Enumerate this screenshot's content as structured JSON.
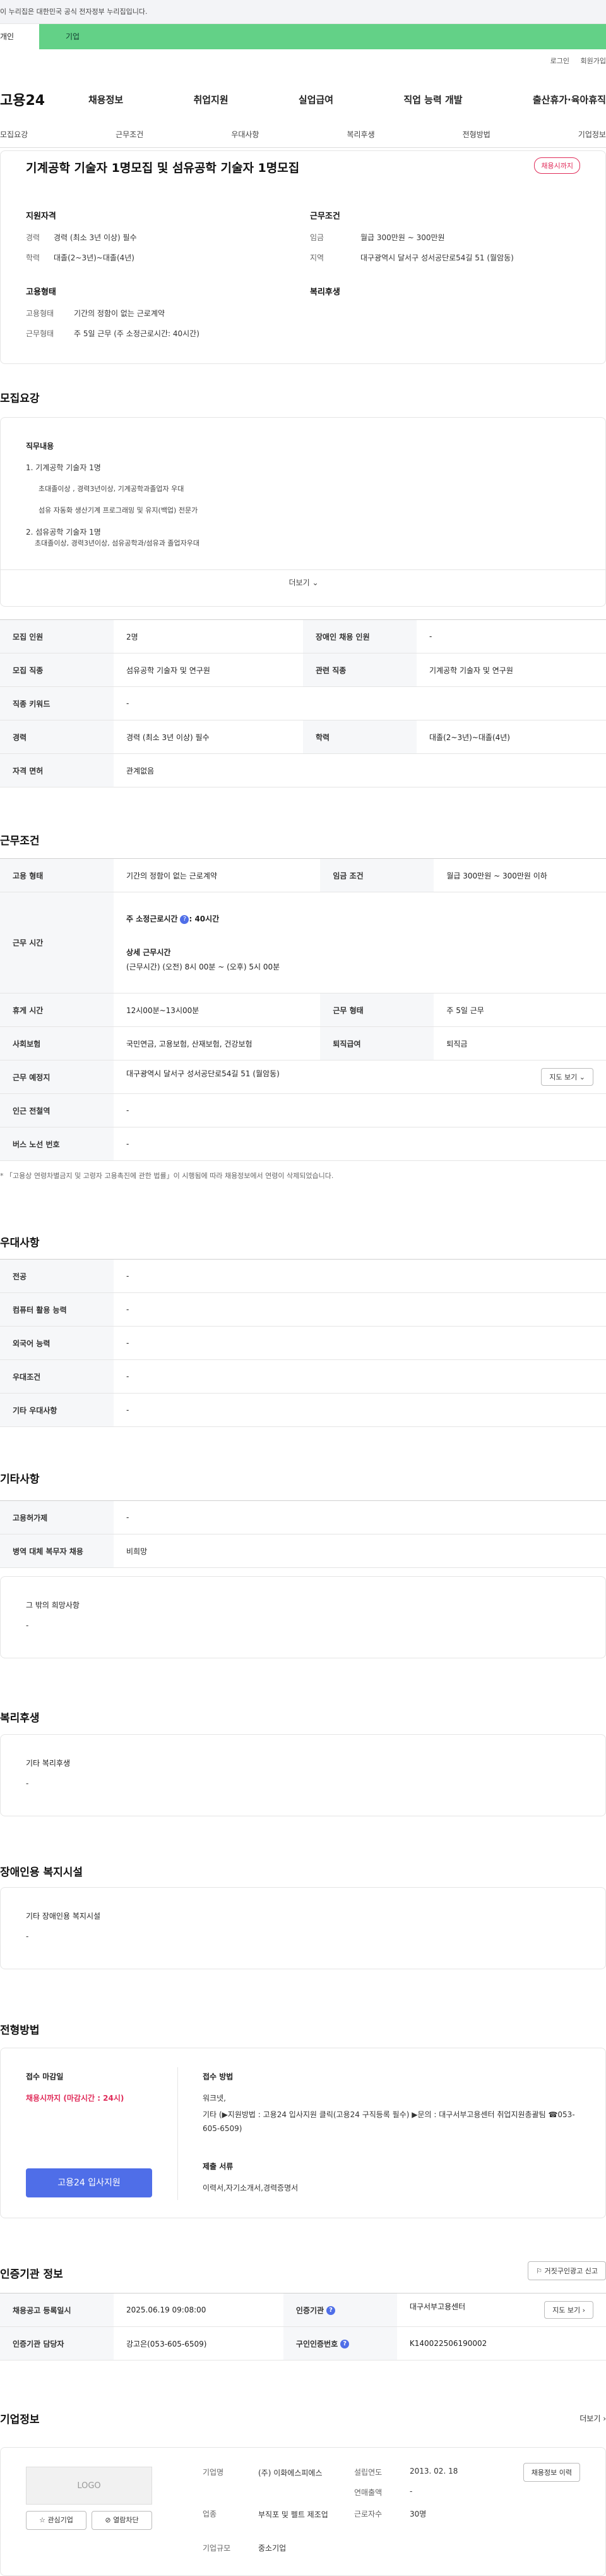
{
  "gov_banner": "이 누리집은 대한민국 공식 전자정부 누리집입니다.",
  "tabs": {
    "t1": "개인",
    "t2": "기업"
  },
  "util": {
    "login": "로그인",
    "join": "회원가입"
  },
  "logo": "고용24",
  "gnb": [
    "채용정보",
    "취업지원",
    "실업급여",
    "직업 능력 개발",
    "출산휴가·육아휴직"
  ],
  "lnb": [
    "모집요강",
    "근무조건",
    "우대사항",
    "복리후생",
    "전형방법",
    "기업정보"
  ],
  "job": {
    "title": "기계공학 기술자 1명모집 및 섬유공학 기술자 1명모집",
    "badge": "채용시까지",
    "support_h": "지원자격",
    "cond_h": "근무조건",
    "type_h": "고용형태",
    "welfare_h": "복리후생",
    "rows": {
      "career_k": "경력",
      "career_v": "경력 (최소 3년 이상) 필수",
      "edu_k": "학력",
      "edu_v": "대졸(2~3년)~대졸(4년)",
      "wage_k": "임금",
      "wage_v": "월급 300만원 ~ 300만원",
      "area_k": "지역",
      "area_v": "대구광역시 달서구 성서공단로54길 51 (월암동)",
      "emp_k": "고용형태",
      "emp_v": "기간의 정함이 없는 근로계약",
      "work_k": "근무형태",
      "work_v": "주 5일 근무 (주 소정근로시간: 40시간)"
    }
  },
  "recruit": {
    "title": "모집요강",
    "duty_h": "직무내용",
    "lines": [
      "1. 기계공학 기술자 1명",
      "초대졸이상 , 경력3년이상, 기계공학과졸업자 우대",
      "섬유 자동화 생산기계 프로그래밍 및 유지(백업) 전문가",
      "2. 섬유공학 기술자 1명",
      "초대졸이상, 경력3년이상, 섬유공학과/섬유과 졸업자우대"
    ],
    "more": "더보기",
    "table": [
      [
        "모집 인원",
        "2명",
        "장애인 채용 인원",
        "-"
      ],
      [
        "모집 직종",
        "섬유공학 기술자 및 연구원",
        "관련 직종",
        "기계공학 기술자 및 연구원"
      ],
      [
        "직종 키워드",
        "-",
        "",
        ""
      ],
      [
        "경력",
        "경력 (최소 3년 이상) 필수",
        "학력",
        "대졸(2~3년)~대졸(4년)"
      ],
      [
        "자격 면허",
        "관계없음",
        "",
        ""
      ]
    ]
  },
  "work": {
    "title": "근무조건",
    "emp_h": "고용 형태",
    "emp_v": "기간의 정함이 없는 근로계약",
    "wage_h": "임금 조건",
    "wage_v": "월급 300만원 ~ 300만원 이하",
    "time_h": "근무 시간",
    "time_1": "주 소정근로시간",
    "time_1v": ": 40시간",
    "time_2": "상세 근무시간",
    "time_3": "(근무시간) (오전) 8시 00분 ~ (오후) 5시 00분",
    "break_h": "휴게 시간",
    "break_v": "12시00분~13시00분",
    "shift_h": "근무 형태",
    "shift_v": "주 5일 근무",
    "ins_h": "사회보험",
    "ins_v": "국민연금, 고용보험, 산재보험, 건강보험",
    "sev_h": "퇴직급여",
    "sev_v": "퇴직금",
    "place_h": "근무 예정지",
    "place_v": "대구광역시 달서구 성서공단로54길 51 (월암동)",
    "map_btn": "지도 보기",
    "sub_h": "인근 전철역",
    "sub_v": "-",
    "bus_h": "버스 노선 번호",
    "bus_v": "-",
    "note": "* 「고용상 연령차별금지 및 고령자 고용촉진에 관한 법률」이 시행됨에 따라 채용정보에서 연령이 삭제되었습니다."
  },
  "pref": {
    "title": "우대사항",
    "rows": [
      [
        "전공",
        "-"
      ],
      [
        "컴퓨터 활용 능력",
        "-"
      ],
      [
        "외국어 능력",
        "-"
      ],
      [
        "우대조건",
        "-"
      ],
      [
        "기타 우대사항",
        "-"
      ]
    ]
  },
  "etc": {
    "title": "기타사항",
    "rows": [
      [
        "고용허가제",
        "-"
      ],
      [
        "병역 대체 복무자 채용",
        "비희망"
      ]
    ],
    "other_h": "그 밖의 희망사항",
    "other_v": "-"
  },
  "welfare": {
    "title": "복리후생",
    "h": "기타 복리후생",
    "v": "-"
  },
  "disabled": {
    "title": "장애인용 복지시설",
    "h": "기타 장애인용 복지시설",
    "v": "-"
  },
  "process": {
    "title": "전형방법",
    "deadline_h": "접수 마감일",
    "deadline_v": "채용시까지 (마감시간 : 24시)",
    "method_h": "접수 방법",
    "method_v1": "워크넷,",
    "method_v2": "기타 (▶지원방법 : 고용24 입사지원 클릭(고용24 구직등록 필수) ▶문의 : 대구서부고용센터 취업지원총괄팀 ☎053-605-6509)",
    "docs_h": "제출 서류",
    "docs_v": "이력서,자기소개서,경력증명서",
    "apply": "고용24 입사지원"
  },
  "cert": {
    "title": "인증기관 정보",
    "report_btn": "거짓구인광고 신고",
    "reg_h": "채용공고 등록일시",
    "reg_v": "2025.06.19 09:08:00",
    "agency_h": "인증기관",
    "agency_v": "대구서부고용센터",
    "map_btn": "지도 보기",
    "mgr_h": "인증기관 담당자",
    "mgr_v": "강고은(053-605-6509)",
    "num_h": "구인인증번호",
    "num_v": "K140022506190002"
  },
  "company": {
    "title": "기업정보",
    "more": "더보기",
    "logo": "LOGO",
    "fav": "관심기업",
    "block": "열람차단",
    "name_h": "기업명",
    "name_v": "(주) 이화에스피에스",
    "est_h": "설립연도",
    "est_v": "2013. 02. 18",
    "info_btn": "채용정보 이력",
    "sales_h": "연매출액",
    "sales_v": "-",
    "ind_h": "업종",
    "ind_v": "부직포 및 펠트 제조업",
    "emp_h": "근로자수",
    "emp_v": "30명",
    "size_h": "기업규모",
    "size_v": "중소기업"
  }
}
